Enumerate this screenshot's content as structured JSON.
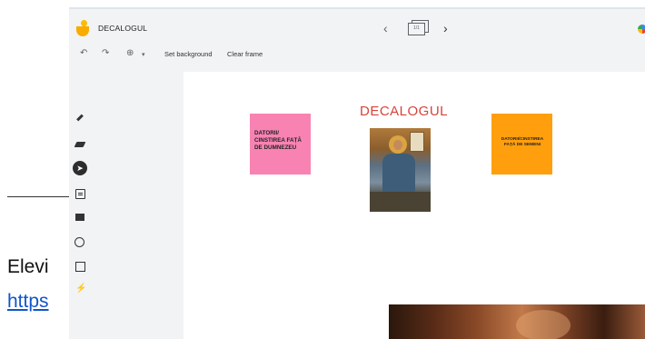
{
  "slide_behind": {
    "text_fragment": "Elevi",
    "link_fragment": "https"
  },
  "app": {
    "title": "DECALOGUL",
    "frame_counter": "1/1",
    "nav": {
      "prev_icon": "chevron-left-icon",
      "next_icon": "chevron-right-icon"
    },
    "toolbar": {
      "undo_icon": "undo-icon",
      "redo_icon": "redo-icon",
      "zoom_icon": "zoom-in-icon",
      "set_background_label": "Set background",
      "clear_frame_label": "Clear frame"
    },
    "tools": [
      "pen-icon",
      "eraser-icon",
      "select-icon",
      "sticky-note-icon",
      "image-icon",
      "circle-icon",
      "text-box-icon",
      "laser-icon"
    ]
  },
  "canvas": {
    "heading": "DECALOGUL",
    "note_left": {
      "text": "DATORII/ CINSTIREA FAȚĂ DE DUMNEZEU",
      "color": "#f883b3"
    },
    "note_right": {
      "text": "DATORII/CINSTIREA FAȚĂ DE SEMENI",
      "color": "#ff9f0e"
    }
  },
  "colors": {
    "heading": "#d8433a",
    "canvas": "#ffffff",
    "app_bg": "#f1f3f4"
  }
}
